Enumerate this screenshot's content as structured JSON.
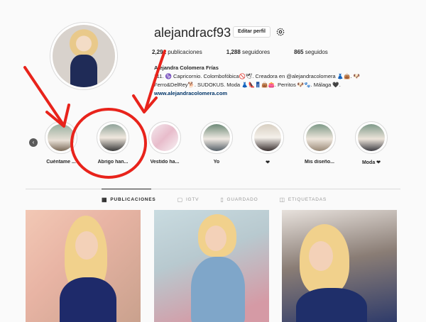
{
  "profile": {
    "username": "alejandracf93",
    "edit_label": "Editar perfil",
    "stats": {
      "posts": "2,291",
      "posts_label": "publicaciones",
      "followers": "1,288",
      "followers_label": "seguidores",
      "following": "865",
      "following_label": "seguidos"
    },
    "bio": {
      "name": "Alejandra Colomera Frías",
      "line1": "111. ♑ Capricornio. Colombofóbica🚫🕊. Creadora en @alejandracolomera 👗👜. 🐶",
      "line2": "Ferro&DelRey🐕. SUDOKUS. Moda 👗👠👖👜👛. Perritos 🐶🐾. Málaga 🖤.",
      "link": "www.alejandracolomera.com"
    }
  },
  "highlights": [
    {
      "label": "Cuéntame ..."
    },
    {
      "label": "Abrigo han..."
    },
    {
      "label": "Vestido ha..."
    },
    {
      "label": "Yo"
    },
    {
      "label": "❤"
    },
    {
      "label": "Mis diseño..."
    },
    {
      "label": "Moda ❤"
    }
  ],
  "tabs": [
    {
      "label": "PUBLICACIONES",
      "icon": "grid-icon"
    },
    {
      "label": "IGTV",
      "icon": "tv-icon"
    },
    {
      "label": "GUARDADO",
      "icon": "bookmark-icon"
    },
    {
      "label": "ETIQUETADAS",
      "icon": "tag-icon"
    }
  ],
  "colors": {
    "annotation_red": "#e8231b",
    "link_blue": "#003569"
  }
}
